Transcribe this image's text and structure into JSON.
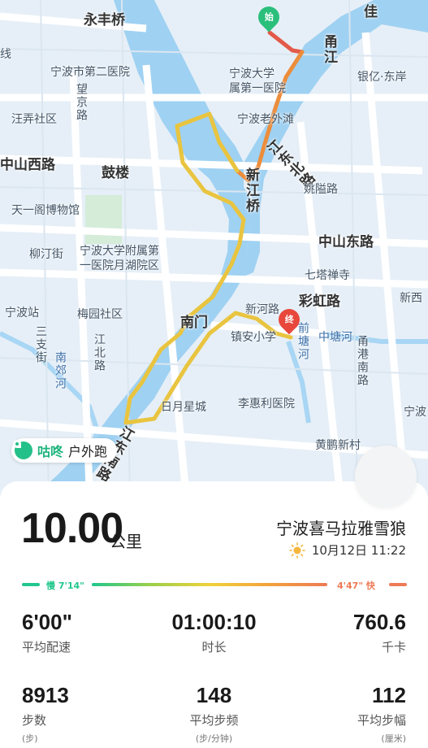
{
  "map": {
    "labels": {
      "yongfeng_bridge": "永丰桥",
      "line": "线",
      "no2_hospital": "宁波市第二医院",
      "wangjing_rd": "望京路",
      "wangjing_sub": "京",
      "lu": "路",
      "wangchun": "汪弄社区",
      "nbu_no1": "宁波大学",
      "nbu_no1_b": "属第一医院",
      "old_bund": "宁波老外滩",
      "zhongshan_w": "中山西路",
      "gulou": "鼓楼",
      "xinjiang_bridge": "新江桥",
      "jiangbei_rd": "江东北路",
      "yaoai_rd": "姚隘路",
      "tianyige": "天一阁博物馆",
      "zhongshan_e": "中山东路",
      "liuting": "柳汀街",
      "yuehu": "宁波大学附属第",
      "yuehu_b": "一医院月湖院区",
      "qita": "七塔禅寺",
      "ningbo_station": "宁波站",
      "meiyuan": "梅园社区",
      "nanmen": "南门",
      "xinhe_rd": "新河路",
      "caihong_rd": "彩虹路",
      "xinxi": "新西",
      "sanzhi_st": "三支街",
      "zhongtang_river": "中塘河",
      "yonggang_rd": "甬港南路",
      "qiantang_river": "前塘河",
      "jiangbei": "江北路",
      "zhenan_school": "镇安小学",
      "nanjiao_rd": "南郊河",
      "lihuili": "李惠利医院",
      "riyue": "日月星城",
      "ning": "宁波",
      "jiangdong_s": "江东南路",
      "huangpeng": "黄鹏新村",
      "yong_river": "甬江",
      "yinyi": "银亿·东岸",
      "jia": "佳",
      "he": "河",
      "lu2": "路",
      "nanshi": "南"
    },
    "start_marker": "始",
    "end_marker": "终"
  },
  "brand": {
    "name": "咕咚",
    "sub": "户外跑"
  },
  "summary": {
    "distance": "10.00",
    "distance_unit": "公里",
    "title": "宁波喜马拉雅雪狼",
    "date": "10月12日 11:22"
  },
  "pace_bar": {
    "slow_label": "慢 7'14\"",
    "fast_label": "4'47\" 快"
  },
  "stats": [
    {
      "value": "6'00\"",
      "label": "平均配速",
      "unit": ""
    },
    {
      "value": "01:00:10",
      "label": "时长",
      "unit": ""
    },
    {
      "value": "760.6",
      "label": "千卡",
      "unit": ""
    },
    {
      "value": "8913",
      "label": "步数",
      "unit": "(步)"
    },
    {
      "value": "148",
      "label": "平均步频",
      "unit": "(步/分钟)"
    },
    {
      "value": "112",
      "label": "平均步幅",
      "unit": "(厘米)"
    }
  ],
  "colors": {
    "route_start": "#e35a4a",
    "route_mid": "#ec8d3b",
    "route_main": "#e9c43f",
    "brand": "#1fb57d",
    "river": "#9fd1f2",
    "map_bg": "#e9f3fa"
  }
}
